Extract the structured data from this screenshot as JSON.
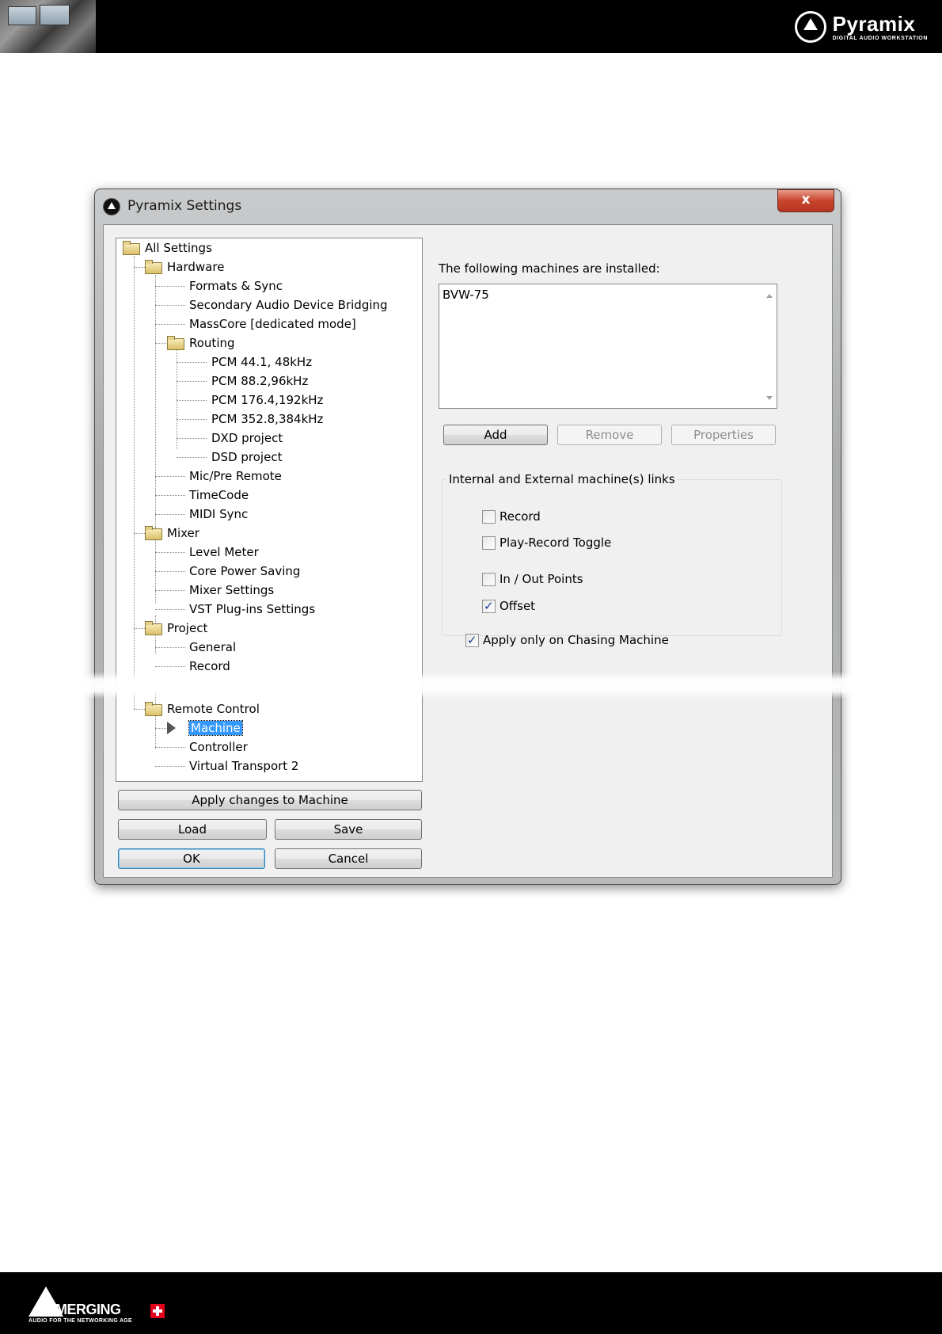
{
  "header": {
    "brand_name": "Pyramix",
    "brand_tagline": "DIGITAL AUDIO WORKSTATION"
  },
  "footer": {
    "brand_name": "MERGING",
    "brand_tagline": "AUDIO FOR THE NETWORKING AGE"
  },
  "window": {
    "title": "Pyramix Settings",
    "close_label": "x"
  },
  "tree": {
    "root": "All Settings",
    "hardware": "Hardware",
    "formats_sync": "Formats & Sync",
    "secondary_bridging": "Secondary Audio Device Bridging",
    "masscore": "MassCore [dedicated mode]",
    "routing": "Routing",
    "pcm_44": "PCM 44.1, 48kHz",
    "pcm_88": "PCM 88.2,96kHz",
    "pcm_176": "PCM 176.4,192kHz",
    "pcm_352": "PCM 352.8,384kHz",
    "dxd": "DXD project",
    "dsd": "DSD project",
    "mic_pre": "Mic/Pre Remote",
    "timecode": "TimeCode",
    "midi_sync": "MIDI Sync",
    "mixer": "Mixer",
    "level_meter": "Level Meter",
    "core_power": "Core Power Saving",
    "mixer_settings": "Mixer Settings",
    "vst": "VST Plug-ins Settings",
    "project": "Project",
    "general": "General",
    "record": "Record",
    "remote_control": "Remote Control",
    "machine": "Machine",
    "controller": "Controller",
    "virtual_transport": "Virtual Transport 2"
  },
  "buttons": {
    "apply": "Apply changes to Machine",
    "load": "Load",
    "save": "Save",
    "ok": "OK",
    "cancel": "Cancel",
    "add": "Add",
    "remove": "Remove",
    "properties": "Properties"
  },
  "machines": {
    "label": "The following machines are installed:",
    "items": [
      "BVW-75"
    ]
  },
  "links_group": {
    "title": "Internal and External machine(s) links",
    "record": "Record",
    "record_checked": false,
    "play_record_toggle": "Play-Record Toggle",
    "play_record_toggle_checked": false,
    "in_out_points": "In / Out Points",
    "in_out_points_checked": false,
    "offset": "Offset",
    "offset_checked": true
  },
  "apply_chasing": {
    "label": "Apply only on Chasing Machine",
    "checked": true
  }
}
